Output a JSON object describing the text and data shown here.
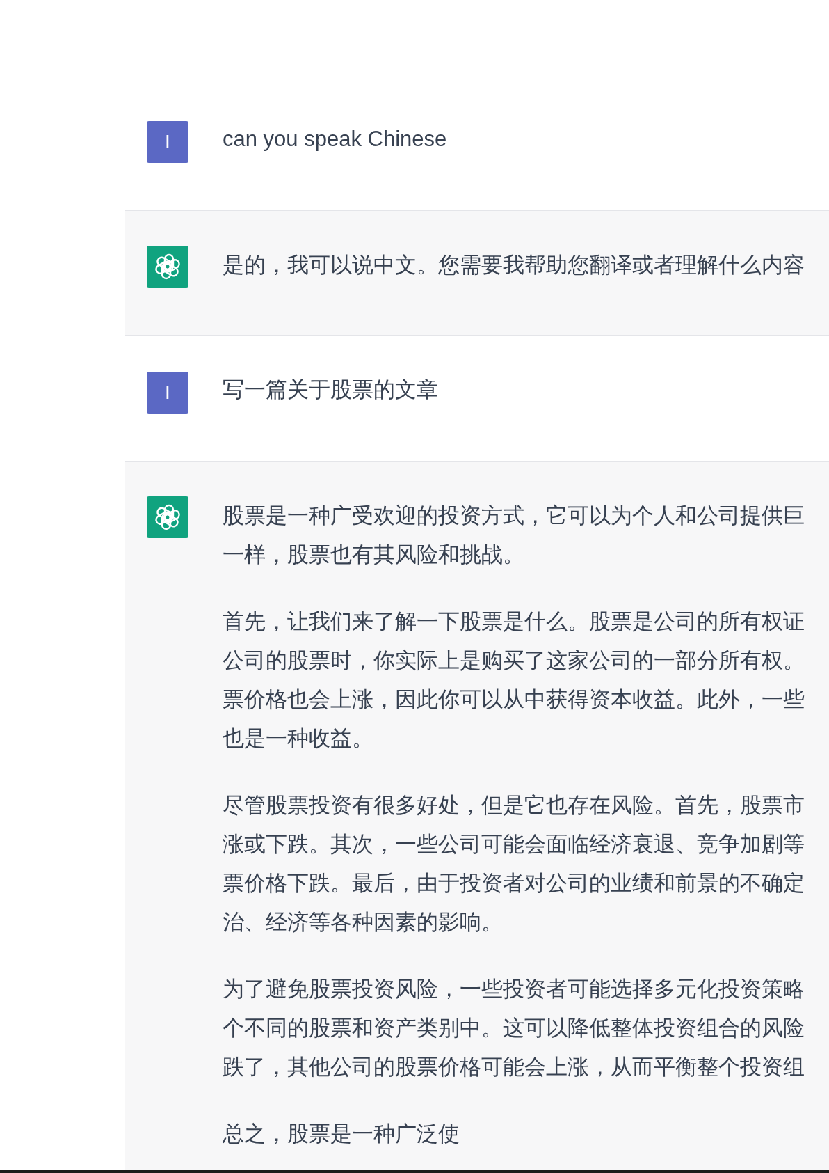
{
  "conversation": {
    "messages": [
      {
        "kind": "user",
        "avatar": "I",
        "paragraphs": [
          {
            "lines": [
              "can you speak Chinese"
            ]
          }
        ]
      },
      {
        "kind": "assistant",
        "paragraphs": [
          {
            "lines": [
              "是的，我可以说中文。您需要我帮助您翻译或者理解什么内容"
            ]
          }
        ]
      },
      {
        "kind": "user",
        "avatar": "I",
        "paragraphs": [
          {
            "lines": [
              "写一篇关于股票的文章"
            ]
          }
        ]
      },
      {
        "kind": "assistant",
        "paragraphs": [
          {
            "lines": [
              "股票是一种广受欢迎的投资方式，它可以为个人和公司提供巨",
              "一样，股票也有其风险和挑战。"
            ]
          },
          {
            "lines": [
              "首先，让我们来了解一下股票是什么。股票是公司的所有权证",
              "公司的股票时，你实际上是购买了这家公司的一部分所有权。",
              "票价格也会上涨，因此你可以从中获得资本收益。此外，一些",
              "也是一种收益。"
            ]
          },
          {
            "lines": [
              "尽管股票投资有很多好处，但是它也存在风险。首先，股票市",
              "涨或下跌。其次，一些公司可能会面临经济衰退、竞争加剧等",
              "票价格下跌。最后，由于投资者对公司的业绩和前景的不确定",
              "治、经济等各种因素的影响。"
            ]
          },
          {
            "lines": [
              "为了避免股票投资风险，一些投资者可能选择多元化投资策略",
              "个不同的股票和资产类别中。这可以降低整体投资组合的风险",
              "跌了，其他公司的股票价格可能会上涨，从而平衡整个投资组"
            ]
          },
          {
            "lines": [
              "总之，股票是一种广泛使"
            ]
          }
        ]
      }
    ]
  }
}
